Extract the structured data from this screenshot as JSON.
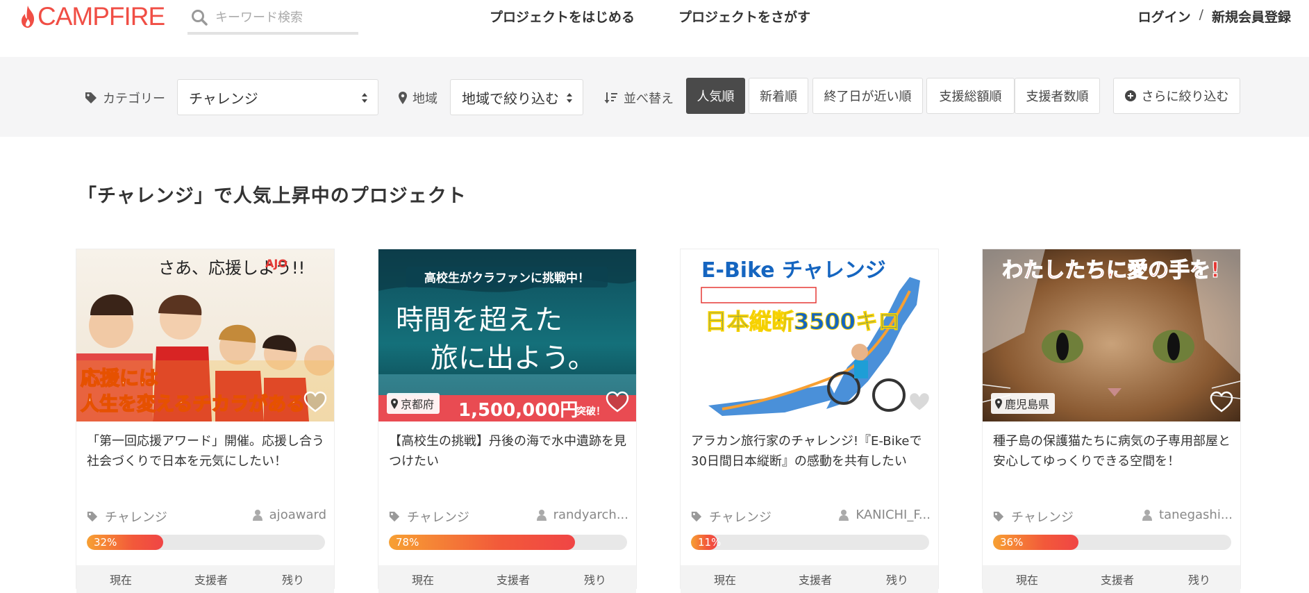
{
  "header": {
    "logo": "CAMPFIRE",
    "search_placeholder": "キーワード検索",
    "nav": [
      "プロジェクトをはじめる",
      "プロジェクトをさがす"
    ],
    "login": "ログイン",
    "separator": "/",
    "register": "新規会員登録"
  },
  "filters": {
    "category_label": "カテゴリー",
    "category_value": "チャレンジ",
    "region_label": "地域",
    "region_value": "地域で絞り込む",
    "sort_label": "並べ替え",
    "sort_options": [
      "人気順",
      "新着順",
      "終了日が近い順",
      "支援総額順",
      "支援者数順"
    ],
    "sort_active": "人気順",
    "more_filters": "さらに絞り込む"
  },
  "section_title": "「チャレンジ」で人気上昇中のプロジェクト",
  "cards": [
    {
      "image_text_top": "さあ、応援しよう!!",
      "image_text_bottom1": "応援には",
      "image_text_bottom2": "人生を変えるチカラがある",
      "badge": "AJO",
      "location": "",
      "title": "「第一回応援アワード」開催。応援し合う社会づくりで日本を元気にしたい！",
      "category": "チャレンジ",
      "owner": "ajoaward",
      "progress": 32,
      "progress_label": "32%",
      "stats": [
        "現在",
        "支援者",
        "残り"
      ]
    },
    {
      "image_text_top": "高校生がクラファンに挑戦中！",
      "image_text_main1": "時間を超えた",
      "image_text_main2": "旅に出よう。",
      "image_text_banner": "1,500,000円",
      "image_text_banner_suffix": "突破！",
      "location": "京都府",
      "title": "【高校生の挑戦】丹後の海で水中遺跡を見つけたい",
      "category": "チャレンジ",
      "owner": "randyarch...",
      "progress": 78,
      "progress_label": "78%",
      "stats": [
        "現在",
        "支援者",
        "残り"
      ]
    },
    {
      "image_text_top": "E-Bike チャレンジ",
      "image_text_main": "日本縦断3500キロ",
      "location": "",
      "title": "アラカン旅行家のチャレンジ!『E-Bikeで30日間日本縦断』の感動を共有したい",
      "category": "チャレンジ",
      "owner": "KANICHI_F...",
      "progress": 11,
      "progress_label": "11%",
      "stats": [
        "現在",
        "支援者",
        "残り"
      ]
    },
    {
      "image_text_top": "わたしたちに愛の手を!",
      "location": "鹿児島県",
      "title": "種子島の保護猫たちに病気の子専用部屋と安心してゆっくりできる空間を！",
      "category": "チャレンジ",
      "owner": "tanegashi...",
      "progress": 36,
      "progress_label": "36%",
      "stats": [
        "現在",
        "支援者",
        "残り"
      ]
    }
  ],
  "colors": {
    "brand": "#f04e45",
    "progress_start": "#f7a033",
    "progress_end": "#f04545"
  }
}
